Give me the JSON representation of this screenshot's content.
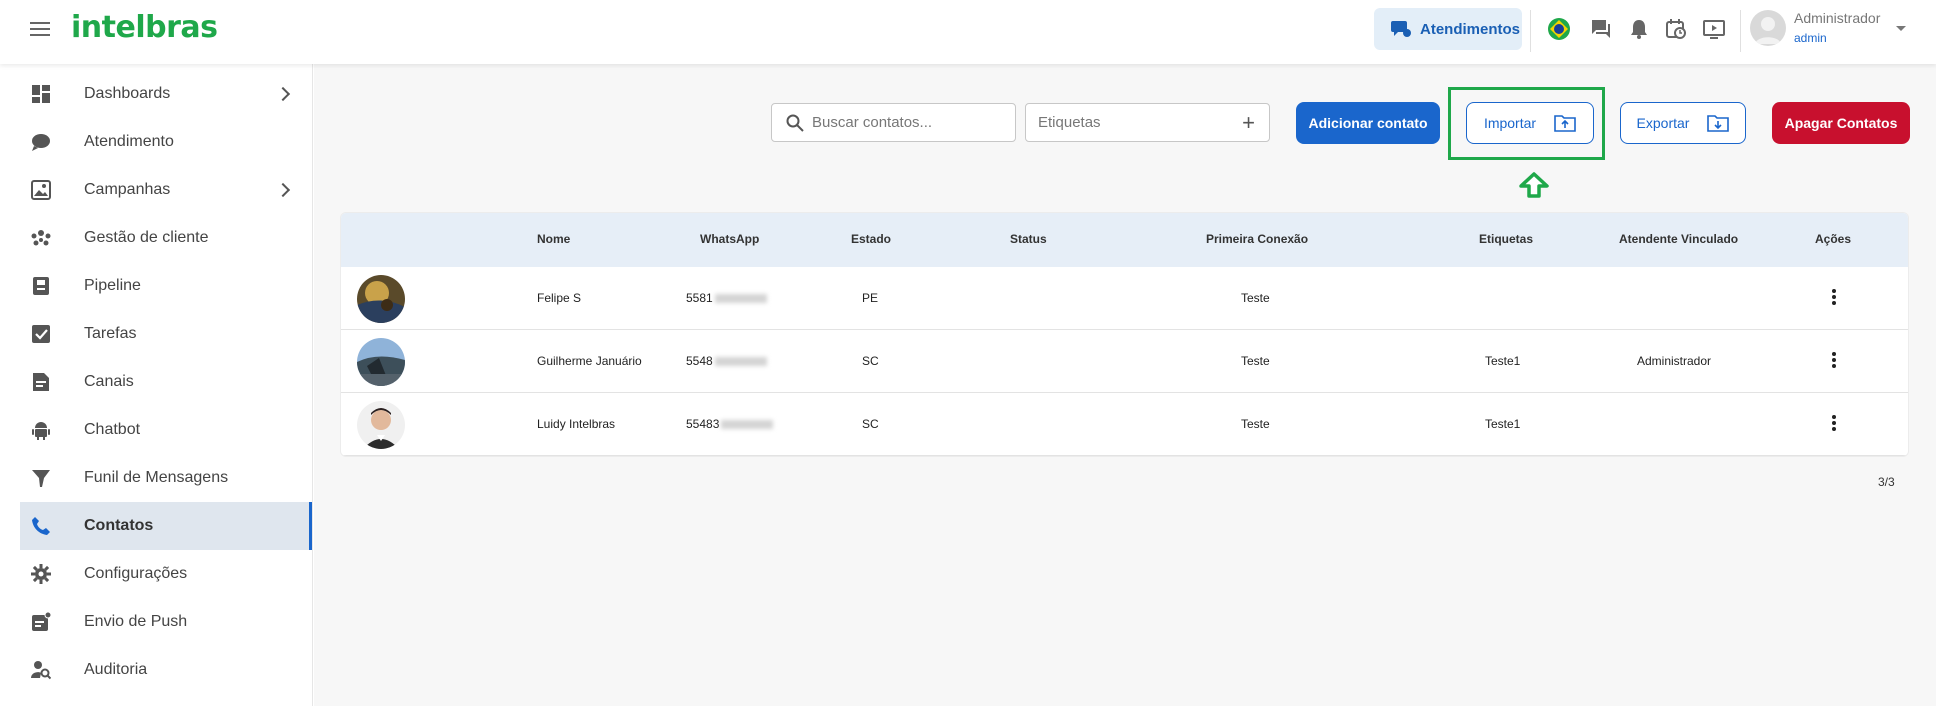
{
  "header": {
    "logo": "intelbras",
    "atendimentos_button": "Atendimentos",
    "user_name": "Administrador",
    "user_role": "admin",
    "icons": [
      "brazil-flag-icon",
      "chat-icon",
      "bell-icon",
      "calendar-clock-icon",
      "video-icon"
    ]
  },
  "sidebar": {
    "items": [
      {
        "label": "Dashboards",
        "icon": "dashboard-icon",
        "has_submenu": true
      },
      {
        "label": "Atendimento",
        "icon": "chat-bubble-icon"
      },
      {
        "label": "Campanhas",
        "icon": "image-icon",
        "has_submenu": true
      },
      {
        "label": "Gestão de cliente",
        "icon": "people-icon"
      },
      {
        "label": "Pipeline",
        "icon": "pipeline-icon"
      },
      {
        "label": "Tarefas",
        "icon": "checkbox-icon"
      },
      {
        "label": "Canais",
        "icon": "document-icon"
      },
      {
        "label": "Chatbot",
        "icon": "android-icon"
      },
      {
        "label": "Funil de Mensagens",
        "icon": "funnel-icon"
      },
      {
        "label": "Contatos",
        "icon": "phone-icon",
        "active": true
      },
      {
        "label": "Configurações",
        "icon": "gear-icon"
      },
      {
        "label": "Envio de Push",
        "icon": "push-icon"
      },
      {
        "label": "Auditoria",
        "icon": "person-search-icon"
      }
    ]
  },
  "toolbar": {
    "search_placeholder": "Buscar contatos...",
    "tags_label": "Etiquetas",
    "add_label": "Adicionar contato",
    "import_label": "Importar",
    "export_label": "Exportar",
    "delete_label": "Apagar Contatos"
  },
  "table": {
    "columns": [
      "Nome",
      "WhatsApp",
      "Estado",
      "Status",
      "Primeira Conexão",
      "Etiquetas",
      "Atendente Vinculado",
      "Ações"
    ],
    "rows": [
      {
        "nome": "Felipe S",
        "whatsapp": "5581",
        "estado": "PE",
        "status": "",
        "primeira_conexao": "Teste",
        "etiquetas": "",
        "atendente": ""
      },
      {
        "nome": "Guilherme Januário",
        "whatsapp": "5548",
        "estado": "SC",
        "status": "",
        "primeira_conexao": "Teste",
        "etiquetas": "Teste1",
        "atendente": "Administrador"
      },
      {
        "nome": "Luidy Intelbras",
        "whatsapp": "55483",
        "estado": "SC",
        "status": "",
        "primeira_conexao": "Teste",
        "etiquetas": "Teste1",
        "atendente": ""
      }
    ]
  },
  "pagination": "3/3",
  "colors": {
    "brand_green": "#1fa84a",
    "primary_blue": "#1a66cc",
    "danger_red": "#c8102e"
  }
}
